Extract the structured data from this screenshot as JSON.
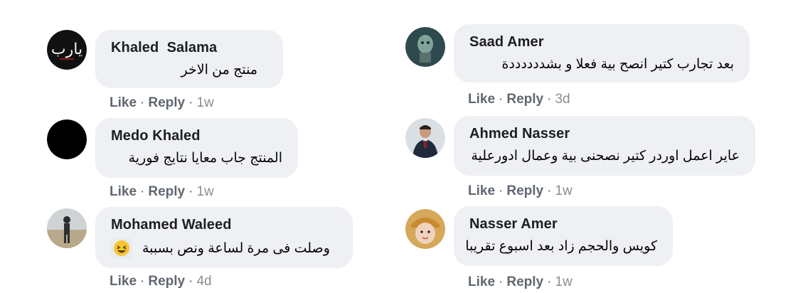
{
  "comments": [
    {
      "name": "Khaled  Salama",
      "text": "منتج من الاخر",
      "avatar_label": "يارب",
      "like": "Like",
      "reply": "Reply",
      "time": "1w"
    },
    {
      "name": "Medo Khaled",
      "text": "المنتج جاب معايا نتايج فورية",
      "like": "Like",
      "reply": "Reply",
      "time": "1w"
    },
    {
      "name": "Mohamed Waleed",
      "text": "وصلت فى مرة لساعة ونص بسببة",
      "emoji": "laughing-face",
      "like": "Like",
      "reply": "Reply",
      "time": "4d"
    },
    {
      "name": "Saad Amer",
      "text": "بعد تجارب كتير انصح بية فعلا و بشددددددة",
      "like": "Like",
      "reply": "Reply",
      "time": "3d"
    },
    {
      "name": "Ahmed Nasser",
      "text": "عاير اعمل اوردر كتير نصحنى بية وعمال ادورعلية",
      "like": "Like",
      "reply": "Reply",
      "time": "1w"
    },
    {
      "name": "Nasser Amer",
      "text": "كويس والحجم زاد بعد اسبوع تقريبا",
      "like": "Like",
      "reply": "Reply",
      "time": "1w"
    }
  ],
  "separator": "·",
  "colors": {
    "bubble": "#eef0f3",
    "action_text": "#606770",
    "name_text": "#1c1e21"
  }
}
